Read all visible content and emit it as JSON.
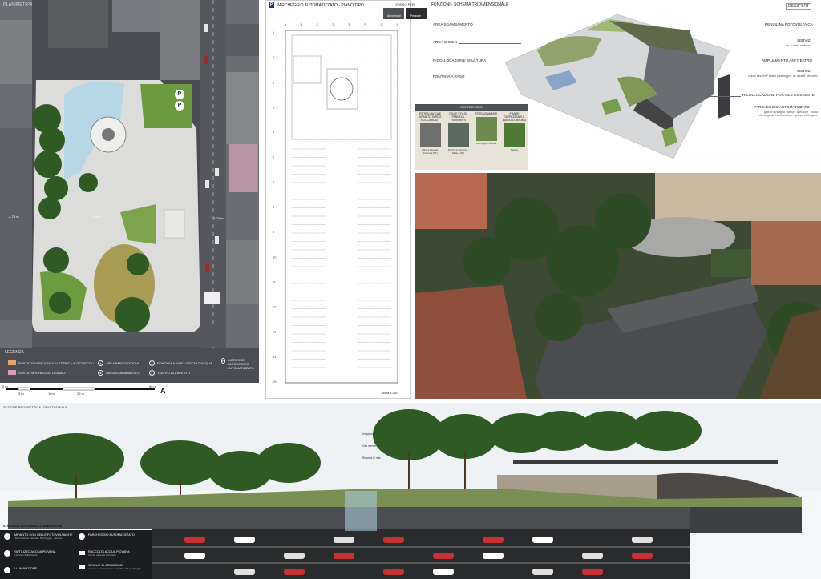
{
  "plan": {
    "title": "PLANIMETRIA",
    "elevations": [
      "-2.24 m",
      "-4.74 m",
      "-4.74 m"
    ],
    "legend_title": "LEGENDA",
    "legend": [
      {
        "label": "POSTAZIONI RICARICA ELETTRICA AUTOVEICOLI",
        "color": "#e8a36a"
      },
      {
        "label": "SOSTA PARCHEGGIO DISABILI",
        "color": "#e19ab6"
      },
      {
        "label": "AREA PARCO GIOCHI",
        "icon": "playground-icon"
      },
      {
        "label": "AREA SGAMBAMENTO",
        "icon": "dog-icon"
      },
      {
        "label": "FONTANA A RASO GIOCHI D'ACQUA",
        "icon": "fountain-icon"
      },
      {
        "label": "TEATRO ALL'APERTO",
        "icon": "theater-icon"
      },
      {
        "label": "INGRESSO PARCHEGGIO AUTOMATIZZATO",
        "icon": "parking-icon"
      }
    ],
    "scale_ticks": [
      "0 m",
      "5 m",
      "15m",
      "25 m",
      "50 m"
    ],
    "north": "A"
  },
  "parking": {
    "badge": "P",
    "title": "PARCHEGGIO AUTOMATIZZATO - PIANO TIPO",
    "spazio_title": "SPAZIO PER",
    "spazio_options": [
      "Autoveicoli",
      "Persone"
    ],
    "scale": "scala 1:200",
    "col_letters": [
      "A",
      "B",
      "C",
      "D",
      "E",
      "F",
      "G",
      "H"
    ],
    "row_numbers": [
      "1",
      "2",
      "3",
      "4",
      "5",
      "6",
      "7",
      "8",
      "9",
      "10",
      "11",
      "12",
      "13",
      "14",
      "15"
    ]
  },
  "functions": {
    "title": "FUNZIONI - SCHEMA TRIDIMENSIONALE",
    "code": "DSS3FSRT",
    "left_labels": [
      "AREA SGAMBAMENTO",
      "AREA GIOCHI",
      "RICOLLOCAZIONE SCULTURA",
      "FONTANA A RASO"
    ],
    "right_labels": [
      {
        "title": "PENSILINA FOTOVOLTAICA",
        "sub": ""
      },
      {
        "title": "SERVIZI",
        "sub": "wc - cabina elettrica"
      },
      {
        "title": "AMPLIAMENTO ANFITEATRO",
        "sub": ""
      },
      {
        "title": "SERVIZI",
        "sub": "volumi idrici/VdF bastio parcheggio · wc disabili · deposito"
      },
      {
        "title": "RICOLLOCAZIONE PORTALE ESISTENTE",
        "sub": ""
      },
      {
        "title": "PARCHEGGIO AUTOMATIZZATO",
        "sub": "gate di consegna · casse · operatore · uscita d'emergenza manutenzione · gruppo elettrogeno"
      }
    ]
  },
  "references": {
    "title": "REFERENCES",
    "items": [
      {
        "label": "PIETRA LAVICA E GRANITO SARDO BOCCIARDATI",
        "caption": "Piazza Moscati, Siracusa (CT)",
        "color": "#6f6f6f"
      },
      {
        "label": "CELLE FTV SU PANNELLI TRAVIMENTI",
        "caption": "Piazza G. Ambrelli, Milano (MI)",
        "color": "#5b6a61"
      },
      {
        "label": "TERRAZZAMENTI",
        "caption": "Campagna Urbana",
        "color": "#6f8a4e"
      },
      {
        "label": "PIANTE TAPPEZZANTI A BASSO CONSUMO",
        "caption": "Sedum",
        "color": "#4f7a35"
      }
    ]
  },
  "section": {
    "title": "SEZIONE PROSPETTICA LONGITUDINALE",
    "strategy_title": "STRATEGIA SOSTENIBILITÀ ENERGETICA",
    "pins": [
      "Irrigazione",
      "Uso mense verdi",
      "Ricarica di rete"
    ],
    "legend": [
      {
        "title": "IMPIANTO CON CELLE FOTOVOLTAICHE",
        "sub": "- Illuminazione esterna - Parcheggio - Altri usi",
        "shape": "dot"
      },
      {
        "title": "RIUTILIZZO ACQUA PIOVANA",
        "sub": "a servizio della piazza",
        "shape": "dot"
      },
      {
        "title": "ILLUMINAZIONE",
        "sub": "",
        "shape": "dot"
      },
      {
        "title": "PARCHEGGIO AUTOMATIZZATO",
        "sub": "",
        "shape": "dot"
      },
      {
        "title": "RACCOLTA ACQUA PIOVANA",
        "sub": "tramite vasca di accumulo",
        "shape": "sq"
      },
      {
        "title": "GRIGLIE DI AREAZIONE",
        "sub": "naturale e meccanica in superficie del parcheggio",
        "shape": "sq"
      }
    ]
  }
}
